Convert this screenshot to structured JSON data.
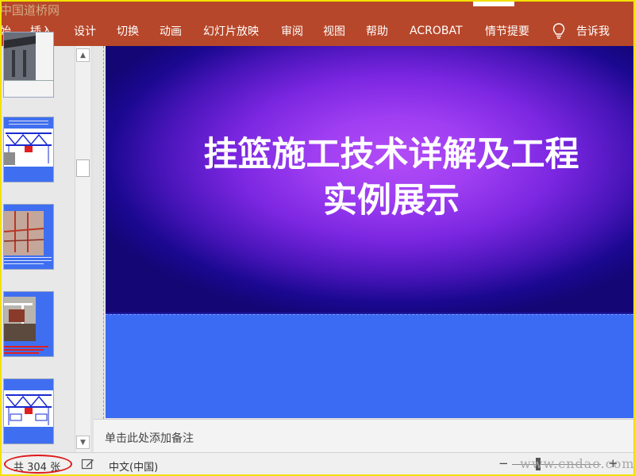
{
  "watermark_top": "中国道桥网",
  "watermark_bottom": "www.cndao.com",
  "ribbon": {
    "tabs": [
      "始",
      "插入",
      "设计",
      "切换",
      "动画",
      "幻灯片放映",
      "审阅",
      "视图",
      "帮助",
      "ACROBAT",
      "情节提要"
    ],
    "tell_me": "告诉我",
    "color": "#b7472a"
  },
  "slide": {
    "title": "挂篮施工技术详解及工程实例展示",
    "title_line1": "挂篮施工技术详解及工程",
    "title_line2": "实例展示"
  },
  "notes": {
    "placeholder": "单击此处添加备注"
  },
  "status": {
    "slide_count": "共 304 张",
    "language": "中文(中国)",
    "zoom_minus": "−",
    "zoom_plus": "+"
  },
  "icons": {
    "tell_me": "lightbulb-icon",
    "notes": "notes-icon",
    "scroll_up": "chevron-up-icon",
    "scroll_down": "chevron-down-icon"
  }
}
